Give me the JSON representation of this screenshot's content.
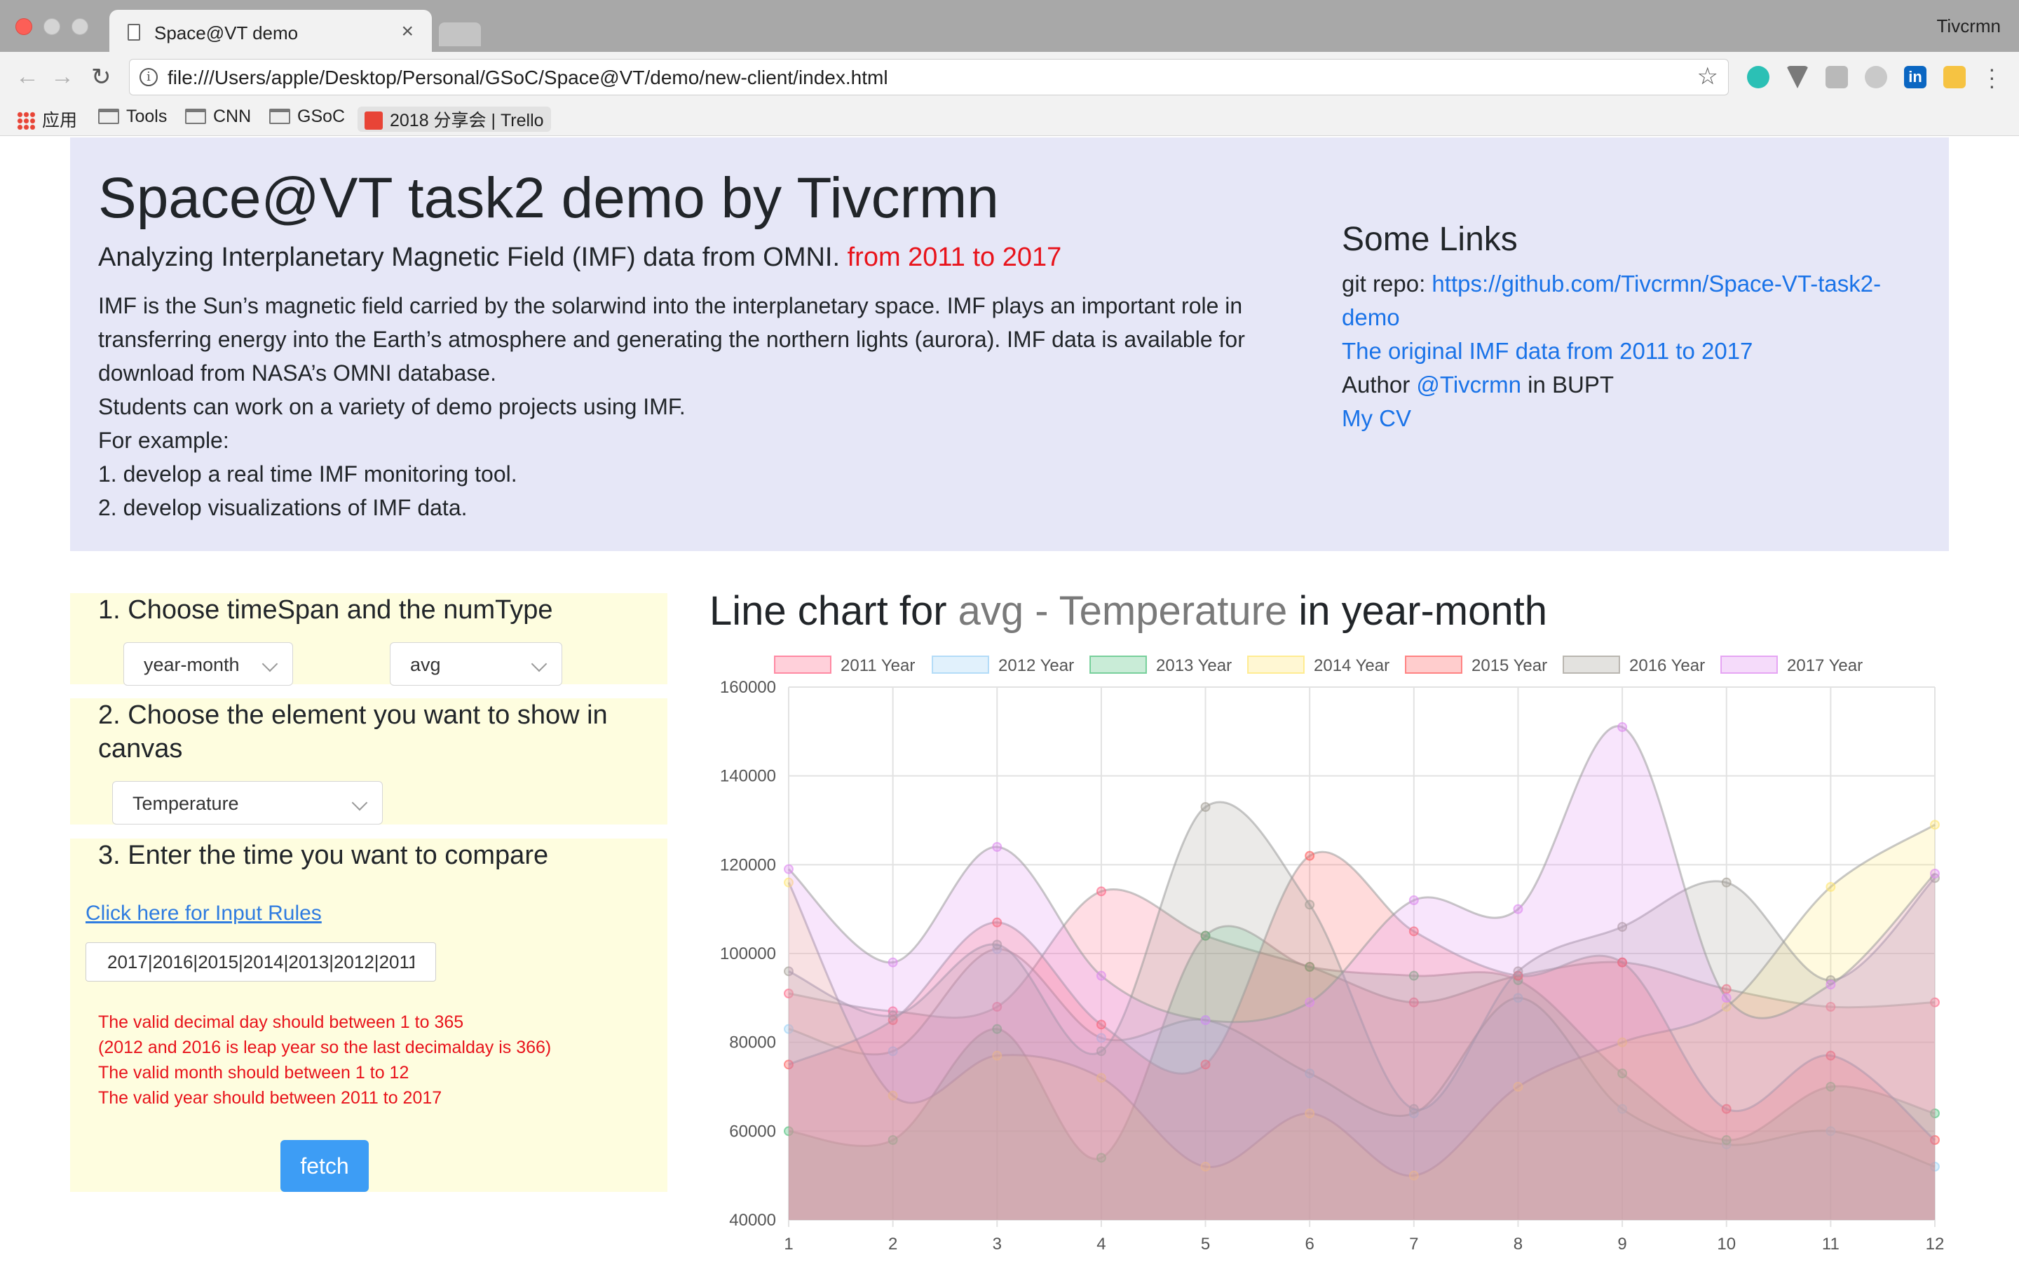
{
  "browser": {
    "tab_title": "Space@VT demo",
    "tab_close": "×",
    "profile_name": "Tivcrmn",
    "url": "file:///Users/apple/Desktop/Personal/GSoC/Space@VT/demo/new-client/index.html",
    "nav_icons": [
      "back-arrow-icon",
      "forward-arrow-icon",
      "reload-icon",
      "info-icon",
      "star-icon"
    ],
    "extension_icons": [
      "mendeley-icon",
      "vue-devtools-icon",
      "pdf-icon",
      "sync-icon",
      "linkedin-icon",
      "notes-icon",
      "menu-icon"
    ],
    "linkedin_glyph": "in",
    "bookmarks": [
      {
        "label": "应用",
        "icon": "apps-grid-icon"
      },
      {
        "label": "Tools",
        "icon": "folder-icon"
      },
      {
        "label": "CNN",
        "icon": "folder-icon"
      },
      {
        "label": "GSoC",
        "icon": "folder-icon"
      },
      {
        "label": "2018 分享会 | Trello",
        "icon": "trello-icon"
      }
    ]
  },
  "header": {
    "title": "Space@VT task2 demo by Tivcrmn",
    "subtitle": "Analyzing Interplanetary Magnetic Field (IMF) data from OMNI.",
    "subtitle_highlight": "from 2011 to 2017",
    "description": [
      "IMF is the Sun’s magnetic field carried by the solarwind into the interplanetary space. IMF plays an important role in",
      "transferring energy into the Earth’s atmosphere and generating the northern lights (aurora). IMF data is available for",
      "download from NASA’s OMNI database.",
      "Students can work on a variety of demo projects using IMF.",
      "For example:",
      "1. develop a real time IMF monitoring tool.",
      "2. develop visualizations of IMF data."
    ]
  },
  "links": {
    "title": "Some Links",
    "git_label": "git repo: ",
    "git_url": "https://github.com/Tivcrmn/Space-VT-task2-demo",
    "original_data": "The original IMF data from 2011 to 2017",
    "author_prefix": "Author ",
    "author_handle": "@Tivcrmn",
    "author_suffix": " in BUPT",
    "cv": "My CV"
  },
  "controls": {
    "step1_title": "1. Choose timeSpan and the numType",
    "timespan_value": "year-month",
    "numtype_value": "avg",
    "step2_title": "2. Choose the element you want to show in canvas",
    "element_value": "Temperature",
    "step3_title": "3. Enter the time you want to compare",
    "rules_link": "Click here for Input Rules",
    "time_input_value": "2017|2016|2015|2014|2013|2012|2011",
    "rules": [
      "The valid decimal day should between 1 to 365",
      "(2012 and 2016 is leap year so the last decimalday is 366)",
      "The valid month should between 1 to 12",
      "The valid year should between 2011 to 2017"
    ],
    "fetch_label": "fetch"
  },
  "chart_title": {
    "prefix": "Line chart for ",
    "highlight": "avg - Temperature",
    "suffix": " in year-month"
  },
  "chart_data": {
    "type": "area",
    "x": [
      1,
      2,
      3,
      4,
      5,
      6,
      7,
      8,
      9,
      10,
      11,
      12
    ],
    "ylim": [
      40000,
      160000
    ],
    "yticks": [
      40000,
      60000,
      80000,
      100000,
      120000,
      140000,
      160000
    ],
    "grid": true,
    "legend_position": "top",
    "series": [
      {
        "name": "2011 Year",
        "fill": "#ff6384",
        "stroke": "#ff6384",
        "values": [
          91000,
          87000,
          88000,
          114000,
          104000,
          97000,
          89000,
          95000,
          98000,
          92000,
          88000,
          89000
        ]
      },
      {
        "name": "2012 Year",
        "fill": "#9ad0f5",
        "stroke": "#9ad0f5",
        "values": [
          83000,
          78000,
          101000,
          81000,
          85000,
          73000,
          64000,
          90000,
          65000,
          57000,
          60000,
          52000
        ]
      },
      {
        "name": "2013 Year",
        "fill": "#4bc07a",
        "stroke": "#4bc07a",
        "values": [
          60000,
          58000,
          83000,
          54000,
          104000,
          97000,
          95000,
          94000,
          73000,
          58000,
          70000,
          64000
        ]
      },
      {
        "name": "2014 Year",
        "fill": "#ffe66e",
        "stroke": "#ffe66e",
        "values": [
          116000,
          68000,
          77000,
          72000,
          52000,
          64000,
          50000,
          70000,
          80000,
          88000,
          115000,
          129000
        ]
      },
      {
        "name": "2015 Year",
        "fill": "#ff5a5a",
        "stroke": "#ff5a5a",
        "values": [
          75000,
          85000,
          107000,
          84000,
          75000,
          122000,
          105000,
          95000,
          98000,
          65000,
          77000,
          58000
        ]
      },
      {
        "name": "2016 Year",
        "fill": "#a39e95",
        "stroke": "#a39e95",
        "values": [
          96000,
          86000,
          102000,
          78000,
          133000,
          111000,
          65000,
          96000,
          106000,
          116000,
          94000,
          117000
        ]
      },
      {
        "name": "2017 Year",
        "fill": "#dd88f0",
        "stroke": "#dd88f0",
        "values": [
          119000,
          98000,
          124000,
          95000,
          85000,
          89000,
          112000,
          110000,
          151000,
          90000,
          93000,
          118000
        ]
      }
    ]
  }
}
